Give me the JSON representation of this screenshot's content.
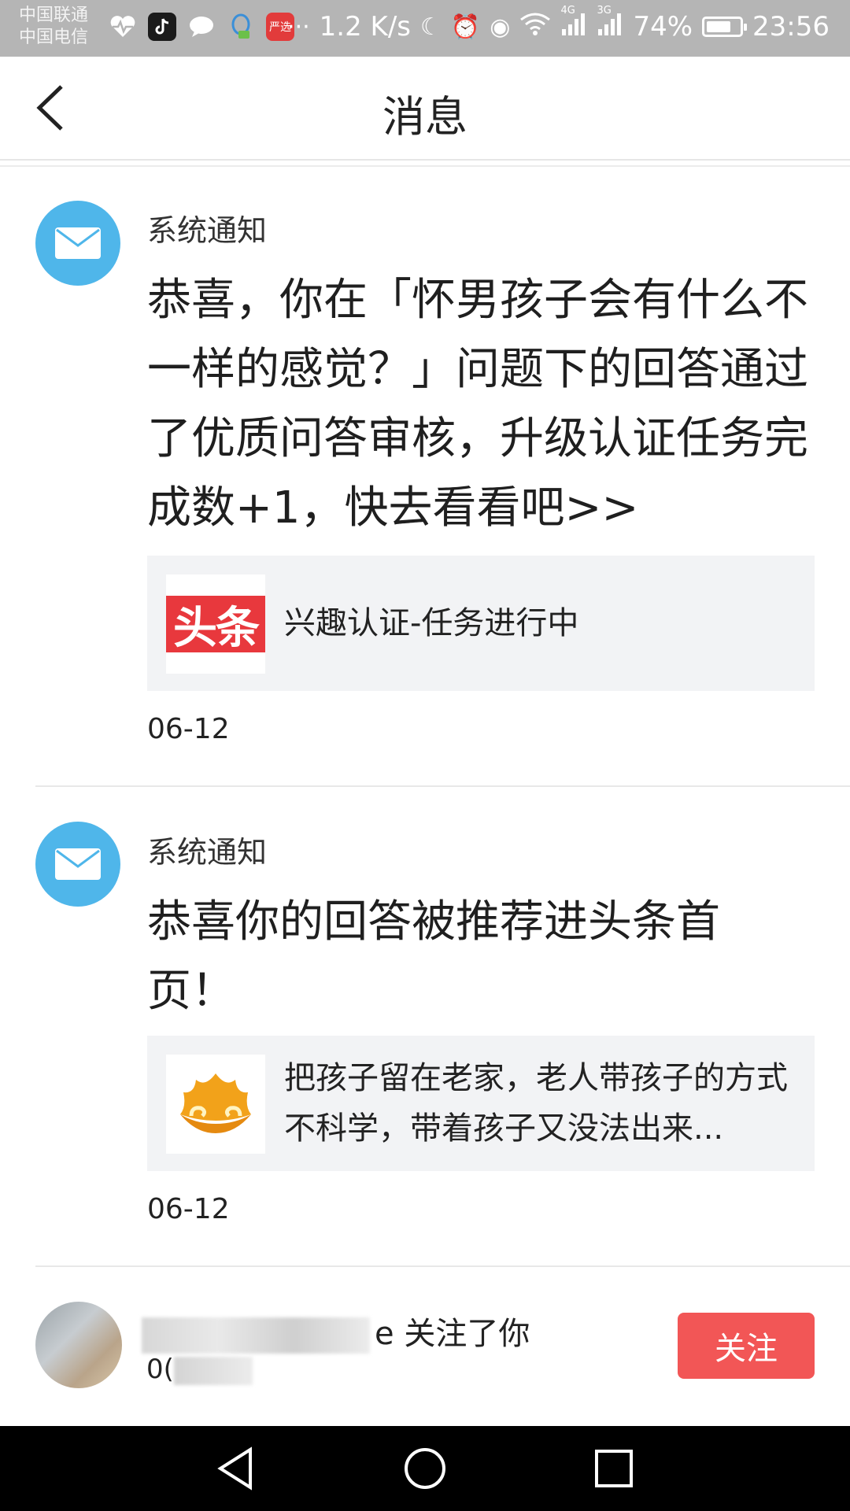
{
  "status_bar": {
    "carrier_1": "中国联通",
    "carrier_2": "中国电信",
    "net_speed": "1.2 K/s",
    "sig_4g": "4G",
    "sig_3g": "3G",
    "battery": "74%",
    "time": "23:56",
    "battery_level": 0.74,
    "app_icons": [
      "heart-pulse-icon",
      "tiktok-icon",
      "chat-icon",
      "qq-icon",
      "yanxuan-icon"
    ]
  },
  "header": {
    "title": "消息"
  },
  "notices": [
    {
      "sender": "系统通知",
      "body": "恭喜，你在「怀男孩子会有什么不一样的感觉？」问题下的回答通过了优质问答审核，升级认证任务完成数+1，快去看看吧>>",
      "attachment": {
        "logo_text": "头条",
        "text": "兴趣认证-任务进行中"
      },
      "date": "06-12"
    },
    {
      "sender": "系统通知",
      "body": "恭喜你的回答被推荐进头条首页！",
      "attachment": {
        "text": "把孩子留在老家，老人带孩子的方式不科学，带着孩子又没法出来..."
      },
      "date": "06-12"
    }
  ],
  "follow": {
    "name_suffix": "e 关注了你",
    "date_prefix": "0(",
    "button": "关注"
  },
  "colors": {
    "accent": "#f25656",
    "mail_blue": "#4fb6ea",
    "toutiao_red": "#e8383d"
  }
}
